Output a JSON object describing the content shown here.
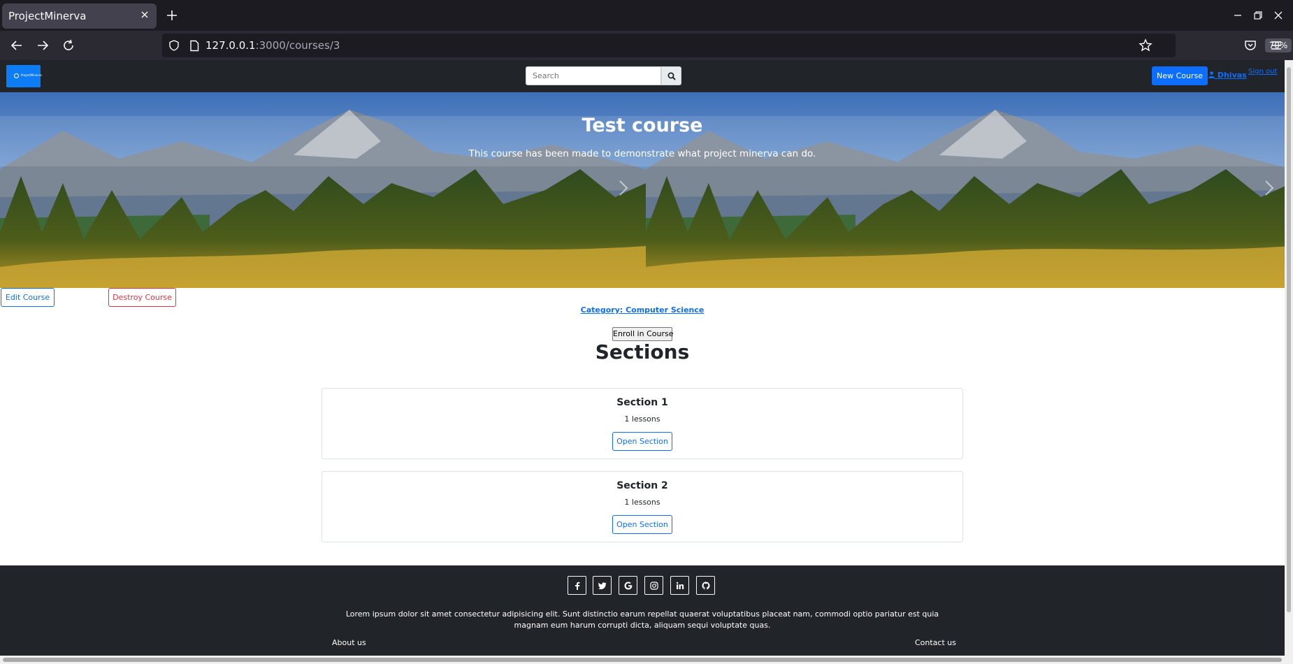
{
  "browser": {
    "tab_title": "ProjectMinerva",
    "url_host": "127.0.0.1",
    "url_rest": ":3000/courses/3",
    "zoom": "70%"
  },
  "site_nav": {
    "brand_text": "ProjectMinerva",
    "search_placeholder": "Search",
    "new_course_label": "New Course",
    "user_name": "Dhivas",
    "sign_out_label": "Sign out"
  },
  "course": {
    "title": "Test course",
    "description": "This course has been made to demonstrate what project minerva can do.",
    "edit_label": "Edit Course",
    "destroy_label": "Destroy Course",
    "category_label": "Category: Computer Science",
    "enroll_label": "Enroll in Course"
  },
  "sections": {
    "heading": "Sections",
    "items": [
      {
        "title": "Section 1",
        "lessons": "1 lessons",
        "open_label": "Open Section"
      },
      {
        "title": "Section 2",
        "lessons": "1 lessons",
        "open_label": "Open Section"
      }
    ]
  },
  "footer": {
    "social_icons": [
      "facebook-icon",
      "twitter-icon",
      "google-icon",
      "instagram-icon",
      "linkedin-icon",
      "github-icon"
    ],
    "text": "Lorem ipsum dolor sit amet consectetur adipisicing elit. Sunt distinctio earum repellat quaerat voluptatibus placeat nam, commodi optio pariatur est quia magnam eum harum corrupti dicta, aliquam sequi voluptate quas.",
    "about_label": "About us",
    "contact_label": "Contact us"
  },
  "colors": {
    "primary": "#0d6efd",
    "danger": "#dc3545",
    "dark": "#212529"
  }
}
